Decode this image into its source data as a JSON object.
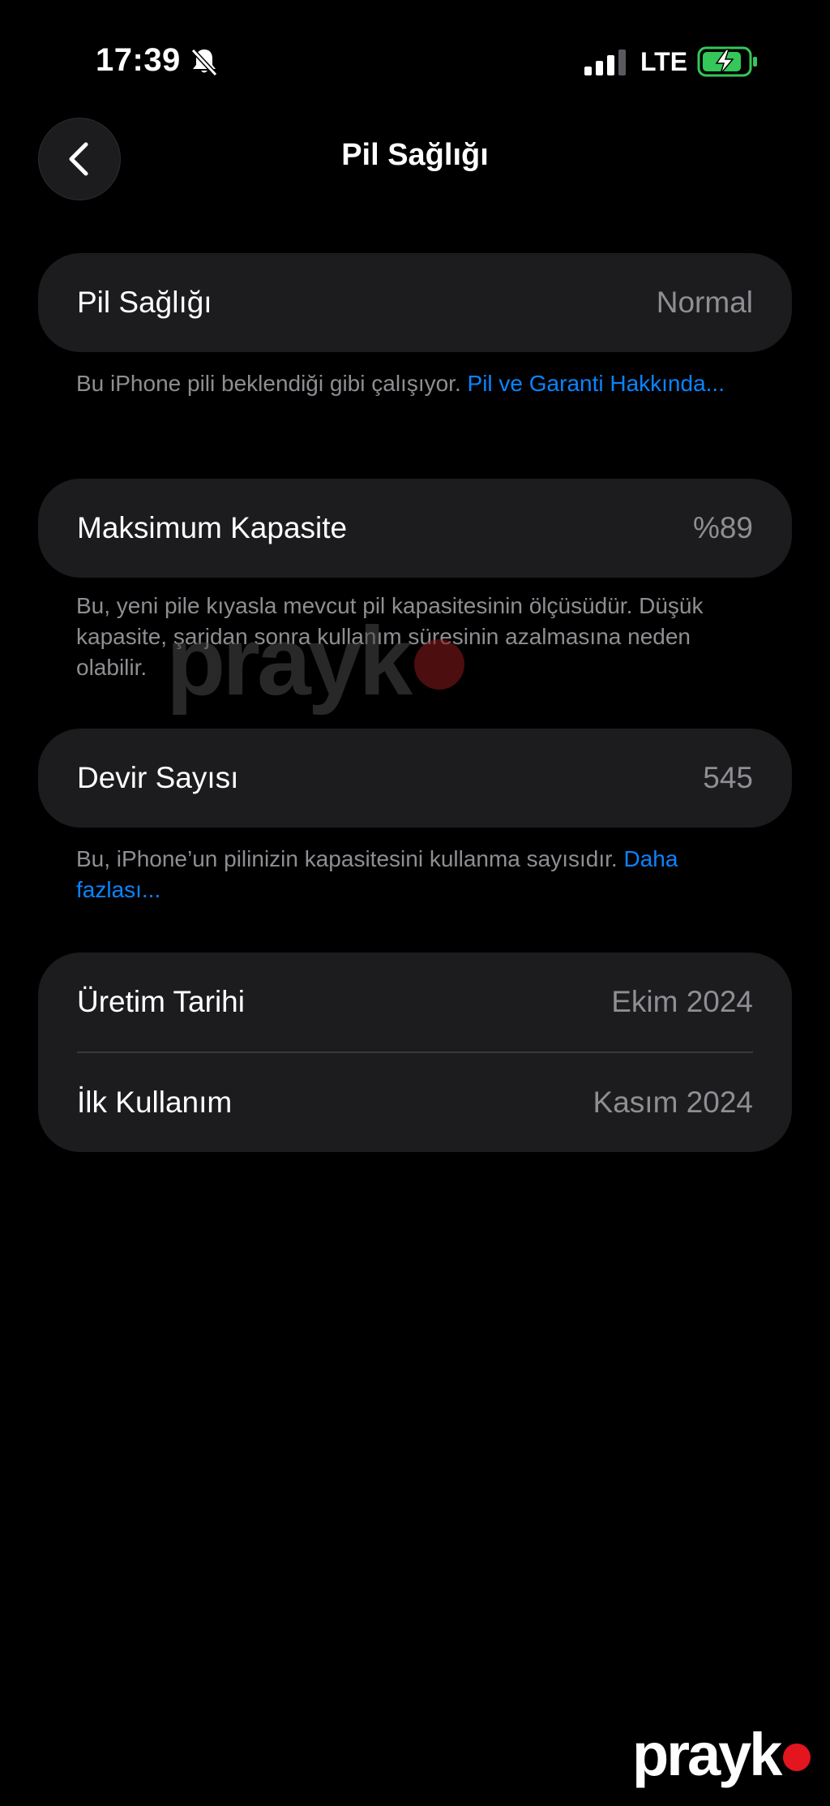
{
  "status_bar": {
    "time": "17:39",
    "silent_icon": "bell-slash-icon",
    "signal_icon": "cellular-signal-icon",
    "network": "LTE",
    "battery_icon": "battery-charging-icon"
  },
  "nav": {
    "back_icon": "chevron-left-icon",
    "title": "Pil Sağlığı"
  },
  "battery_health": {
    "label": "Pil Sağlığı",
    "value": "Normal",
    "footnote_text": "Bu iPhone pili beklendiği gibi çalışıyor. ",
    "footnote_link": "Pil ve Garanti Hakkında..."
  },
  "max_capacity": {
    "label": "Maksimum Kapasite",
    "value": "%89",
    "footnote_text": "Bu, yeni pile kıyasla mevcut pil kapasitesinin ölçüsüdür. Düşük kapasite, şarjdan sonra kullanım süresinin azalmasına neden olabilir."
  },
  "cycle_count": {
    "label": "Devir Sayısı",
    "value": "545",
    "footnote_text": "Bu, iPhone’un pilinizin kapasitesini kullanma sayısıdır. ",
    "footnote_link": "Daha fazlası..."
  },
  "dates": {
    "manufacture_label": "Üretim Tarihi",
    "manufacture_value": "Ekim 2024",
    "first_use_label": "İlk Kullanım",
    "first_use_value": "Kasım 2024"
  },
  "watermark": {
    "text": "prayk",
    "accent_color": "#e3151e"
  },
  "colors": {
    "background": "#000000",
    "card": "#1c1c1e",
    "secondary_text": "#8e8e93",
    "link": "#0a84ff",
    "battery_green": "#34c759"
  }
}
